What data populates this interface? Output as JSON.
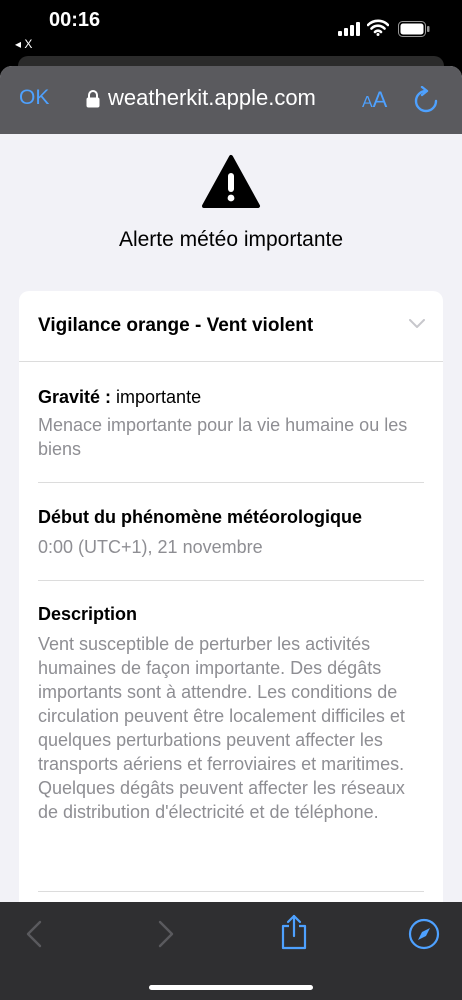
{
  "status_bar": {
    "time": "00:16",
    "back_app": "◂ X"
  },
  "url_bar": {
    "done_label": "OK",
    "url": "weatherkit.apple.com",
    "text_size_small": "A",
    "text_size_large": "A"
  },
  "page": {
    "title": "Alerte météo importante",
    "alert": {
      "heading": "Vigilance orange - Vent violent",
      "severity_label": "Gravité :",
      "severity_value": " importante",
      "severity_desc": "Menace importante pour la vie humaine ou les biens",
      "start_label": "Début du phénomène météorologique",
      "start_value": "0:00 (UTC+1), 21 novembre",
      "description_label": "Description",
      "description_text": "Vent susceptible de perturber les activités humaines de façon importante. Des dégâts importants sont à attendre. Les conditions de circulation peuvent être localement difficiles et quelques perturbations peuvent affecter les transports aériens et ferroviaires et maritimes. Quelques dégâts peuvent affecter les réseaux de distribution d'électricité et de téléphone."
    }
  },
  "toolbar": {
    "icons": [
      "chevron-left-icon",
      "chevron-right-icon",
      "share-icon",
      "compass-icon"
    ]
  },
  "colors": {
    "accent": "#4ea1ff",
    "url_bar": "#5a5a5e",
    "toolbar": "#2f2f31",
    "background": "#f2f2f7"
  }
}
